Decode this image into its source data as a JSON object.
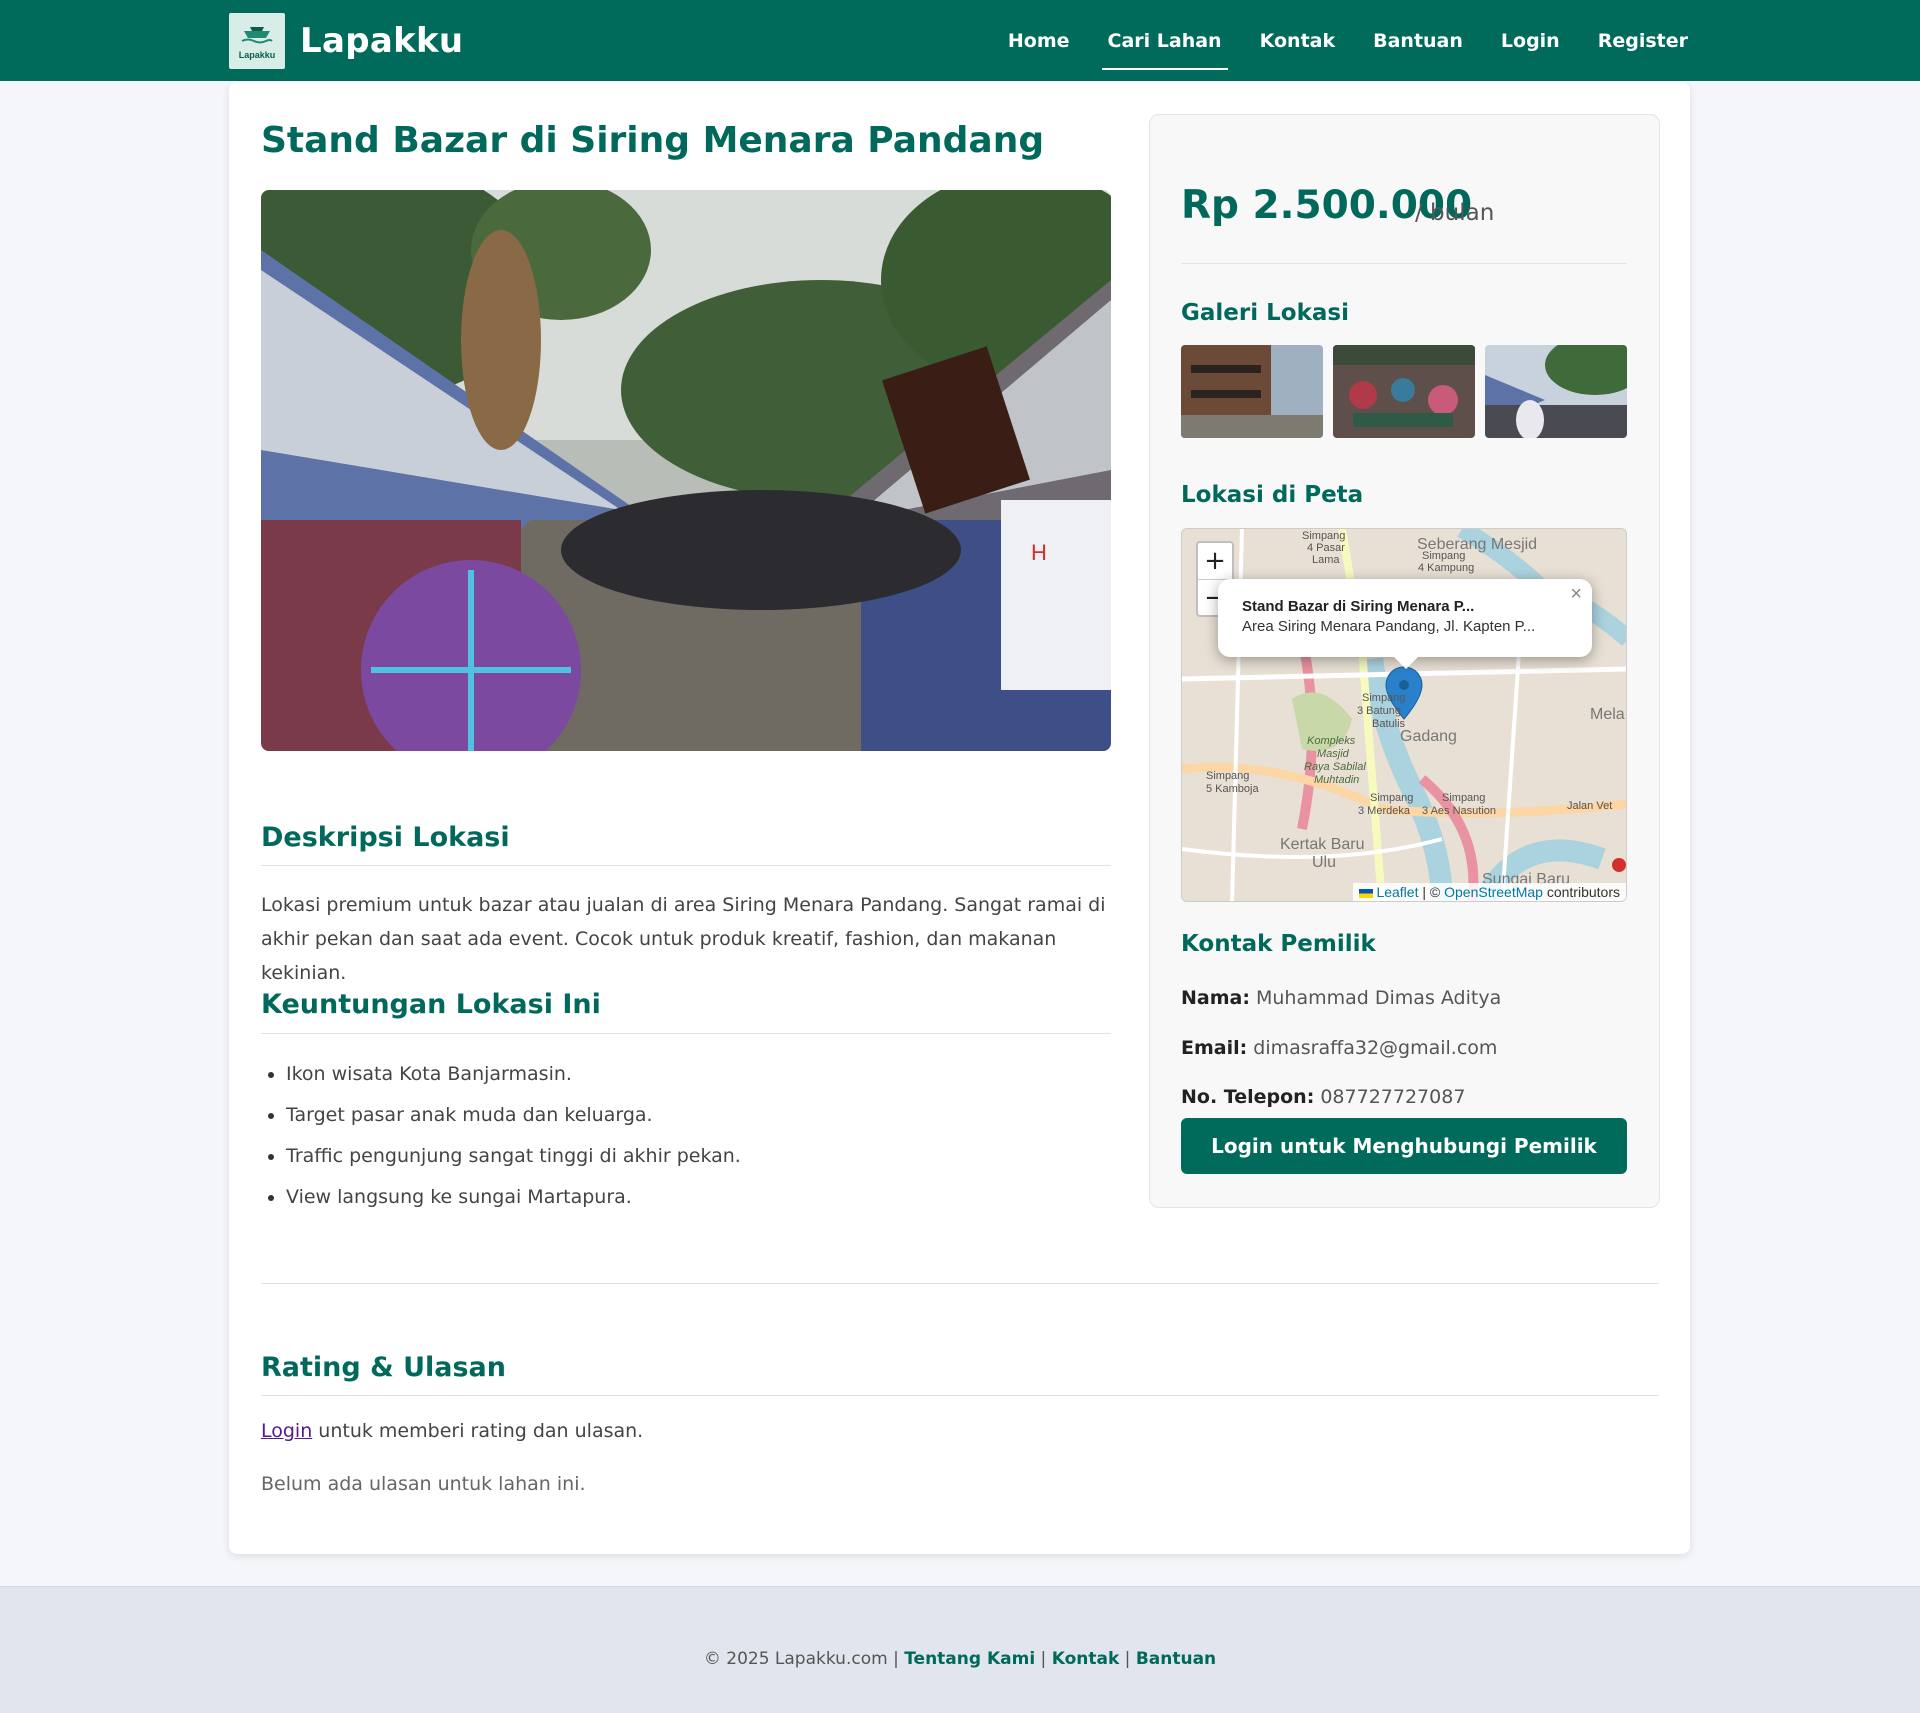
{
  "nav": {
    "brand": "Lapakku",
    "logo_text": "Lapakku",
    "links": [
      "Home",
      "Cari Lahan",
      "Kontak",
      "Bantuan",
      "Login",
      "Register"
    ],
    "active": "Cari Lahan"
  },
  "listing": {
    "title": "Stand Bazar di Siring Menara Pandang",
    "description_heading": "Deskripsi Lokasi",
    "description": "Lokasi premium untuk bazar atau jualan di area Siring Menara Pandang. Sangat ramai di akhir pekan dan saat ada event. Cocok untuk produk kreatif, fashion, dan makanan kekinian.",
    "benefits_heading": "Keuntungan Lokasi Ini",
    "benefits": [
      "Ikon wisata Kota Banjarmasin.",
      "Target pasar anak muda dan keluarga.",
      "Traffic pengunjung sangat tinggi di akhir pekan.",
      "View langsung ke sungai Martapura."
    ]
  },
  "sidebar": {
    "price": "Rp 2.500.000",
    "price_unit": "/ bulan",
    "gallery_heading": "Galeri Lokasi",
    "map_heading": "Lokasi di Peta",
    "map": {
      "zoom_in": "+",
      "zoom_out": "−",
      "popup_title": "Stand Bazar di Siring Menara P...",
      "popup_address": "Area Siring Menara Pandang, Jl. Kapten P...",
      "popup_close": "×",
      "attribution_leaflet": "Leaflet",
      "attribution_sep": " | © ",
      "attribution_osm": "OpenStreetMap",
      "attribution_suffix": " contributors",
      "place_labels": [
        "Simpang 4 Pasar Lama",
        "Seberang Mesjid",
        "Simpang 4 Kampung",
        "Simpang 3 Batung Batulis",
        "Gadang",
        "Kompleks Masjid Raya Sabilal Muhtadin",
        "Simpang 5 Kamboja",
        "Simpang 3 Merdeka",
        "Simpang 3 Aes Nasution",
        "Kertak Baru Ulu",
        "Sungai Baru",
        "Jalan Veteran",
        "Mela"
      ]
    },
    "contact_heading": "Kontak Pemilik",
    "contact": {
      "name_label": "Nama:",
      "name": "Muhammad Dimas Aditya",
      "email_label": "Email:",
      "email": "dimasraffa32@gmail.com",
      "phone_label": "No. Telepon:",
      "phone": "087727727087"
    },
    "cta": "Login untuk Menghubungi Pemilik"
  },
  "reviews": {
    "heading": "Rating & Ulasan",
    "login_link": "Login",
    "login_suffix": " untuk memberi rating dan ulasan.",
    "empty": "Belum ada ulasan untuk lahan ini."
  },
  "footer": {
    "copyright": "© 2025 Lapakku.com | ",
    "links": [
      "Tentang Kami",
      "Kontak",
      "Bantuan"
    ],
    "sep": " | "
  },
  "colors": {
    "primary": "#006b5a",
    "heading": "#00695c",
    "footer_bg": "#e1e6ee"
  }
}
